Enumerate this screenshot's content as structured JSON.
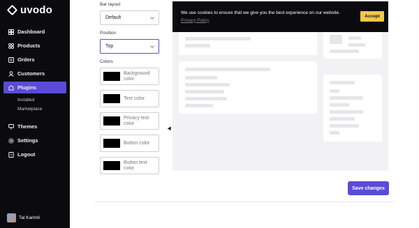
{
  "app": {
    "logo_text": "uvodo"
  },
  "sidebar": {
    "items": [
      {
        "label": "Dashboard",
        "icon": "grid-icon"
      },
      {
        "label": "Products",
        "icon": "box-icon"
      },
      {
        "label": "Orders",
        "icon": "orders-icon"
      },
      {
        "label": "Customers",
        "icon": "users-icon"
      },
      {
        "label": "Plugins",
        "icon": "plugin-icon"
      }
    ],
    "sub_items": [
      {
        "label": "Installed"
      },
      {
        "label": "Marketplace"
      }
    ],
    "bottom_items": [
      {
        "label": "Themes",
        "icon": "themes-icon"
      },
      {
        "label": "Settings",
        "icon": "gear-icon"
      },
      {
        "label": "Logout",
        "icon": "logout-icon"
      }
    ],
    "user": {
      "name": "Tal Karimli"
    },
    "active_color": "#5a4bd6"
  },
  "settings": {
    "bar_layout": {
      "label": "Bar layout",
      "value": "Default"
    },
    "position": {
      "label": "Position",
      "value": "Top"
    },
    "colors": {
      "label": "Colors",
      "items": [
        {
          "label": "Background color",
          "value": "#000000"
        },
        {
          "label": "Text color",
          "value": "#000000"
        },
        {
          "label": "Privacy text color",
          "value": "#000000"
        },
        {
          "label": "Button color",
          "value": "#000000"
        },
        {
          "label": "Button text color",
          "value": "#000000"
        }
      ]
    }
  },
  "preview": {
    "cookie_text": "We use cookies to ensure that we give you the best experience on our website.",
    "cookie_link": "Privacy Policy",
    "accept_label": "Accept",
    "accent": "#f3c84a"
  },
  "footer": {
    "save_label": "Save changes"
  }
}
